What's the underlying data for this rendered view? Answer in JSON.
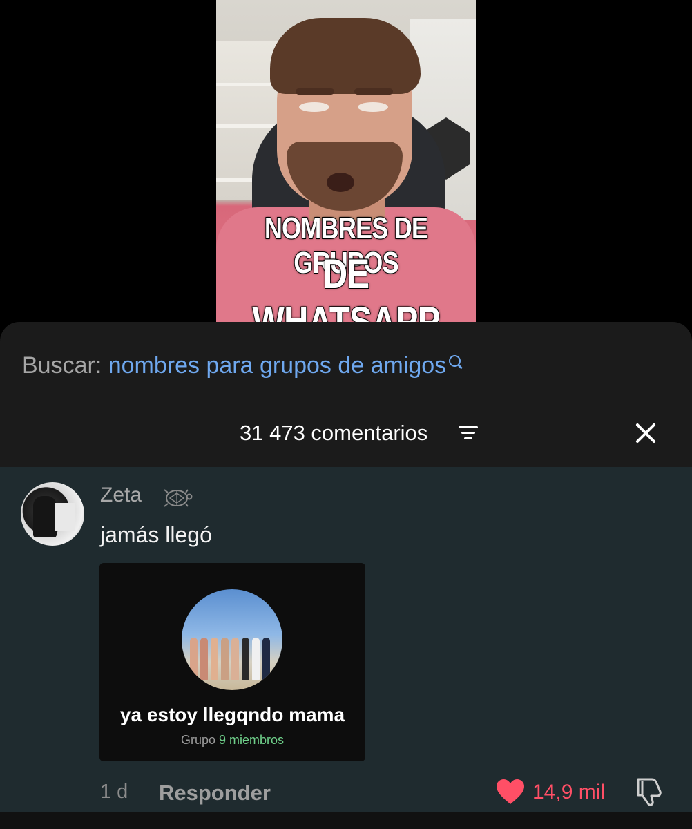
{
  "video": {
    "caption_line1": "NOMBRES DE GRUPOS",
    "caption_line2": "DE WHATSAPP"
  },
  "search": {
    "prefix": "Buscar:",
    "query": "nombres para grupos de amigos",
    "icon": "search-icon"
  },
  "comments_header": {
    "count_label": "31 473 comentarios",
    "sort_icon": "sort-icon",
    "close_icon": "close-icon"
  },
  "comment": {
    "username": "Zeta",
    "badge_icon": "turtle-icon",
    "text": "jamás llegó",
    "attachment": {
      "group_name": "ya estoy llegqndo mama",
      "group_type": "Grupo",
      "members": "9 miembros"
    },
    "time": "1 d",
    "reply_label": "Responder",
    "likes": "14,9 mil",
    "liked": true
  },
  "colors": {
    "link_blue": "#6fa8ef",
    "like_red": "#ff4f66",
    "members_green": "#6fd08a",
    "comment_bg": "#1f2b2f",
    "sheet_bg": "#1b1b1b"
  }
}
